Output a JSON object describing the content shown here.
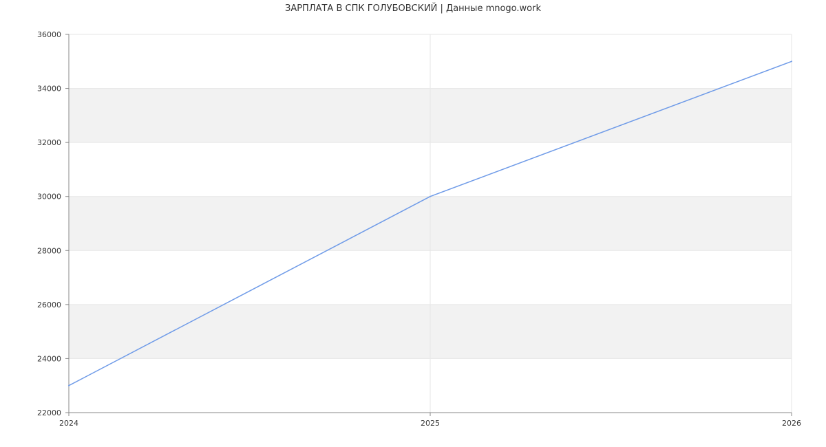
{
  "chart_data": {
    "type": "line",
    "title": "ЗАРПЛАТА В СПК ГОЛУБОВСКИЙ | Данные mnogo.work",
    "x": [
      2024,
      2025,
      2026
    ],
    "series": [
      {
        "values": [
          23000,
          30000,
          35000
        ],
        "color": "#6f9be8"
      }
    ],
    "xlim": [
      2024,
      2026
    ],
    "ylim": [
      22000,
      36000
    ],
    "x_ticks": [
      "2024",
      "2025",
      "2026"
    ],
    "y_ticks": [
      "22000",
      "24000",
      "26000",
      "28000",
      "30000",
      "32000",
      "34000",
      "36000"
    ],
    "grid": true,
    "band_color": "#f2f2f2",
    "grid_color": "#e6e6e6",
    "axis_color": "#888888"
  }
}
